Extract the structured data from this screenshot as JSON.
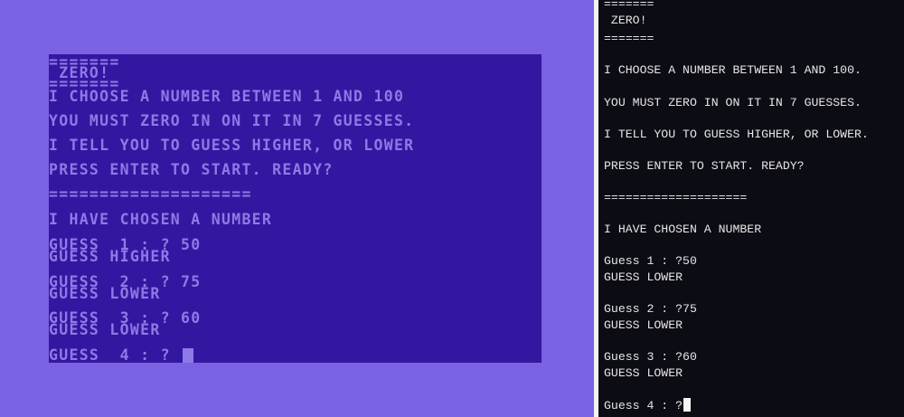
{
  "c64": {
    "lines": [
      "=======",
      " ZERO!",
      "=======",
      "I CHOOSE A NUMBER BETWEEN 1 AND 100",
      "YOU MUST ZERO IN ON IT IN 7 GUESSES.",
      "I TELL YOU TO GUESS HIGHER, OR LOWER",
      "PRESS ENTER TO START. READY?",
      "====================",
      "I HAVE CHOSEN A NUMBER",
      "GUESS  1 : ? 50",
      "GUESS HIGHER",
      "GUESS  2 : ? 75",
      "GUESS LOWER",
      "GUESS  3 : ? 60",
      "GUESS LOWER",
      "GUESS  4 : ? "
    ]
  },
  "terminal": {
    "lines": [
      "=======",
      " ZERO!",
      "=======",
      "I CHOOSE A NUMBER BETWEEN 1 AND 100.",
      "YOU MUST ZERO IN ON IT IN 7 GUESSES.",
      "I TELL YOU TO GUESS HIGHER, OR LOWER.",
      "PRESS ENTER TO START. READY?",
      "====================",
      "I HAVE CHOSEN A NUMBER",
      "Guess 1 : ?50",
      "GUESS LOWER",
      "Guess 2 : ?75",
      "GUESS LOWER",
      "Guess 3 : ?60",
      "GUESS LOWER",
      "Guess 4 : ?"
    ]
  }
}
